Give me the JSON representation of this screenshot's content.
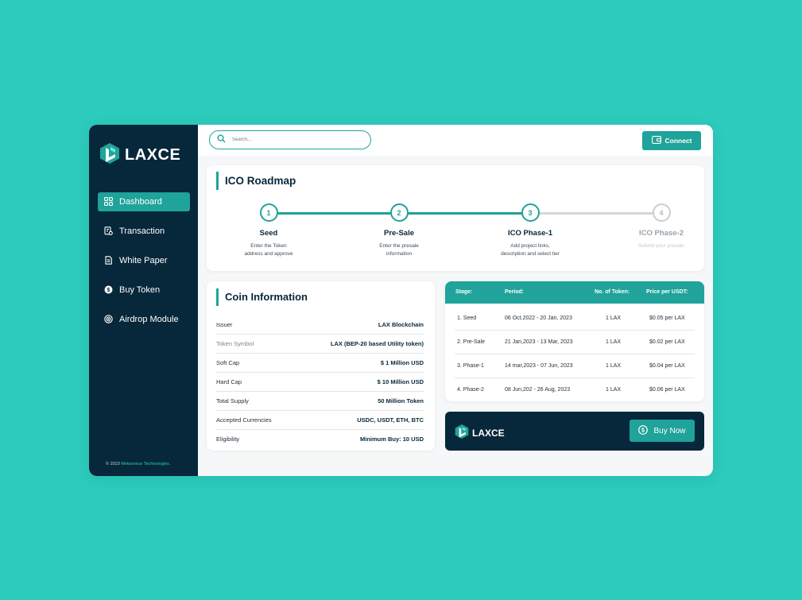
{
  "brand": {
    "name": "LAXCE"
  },
  "sidebar": {
    "items": [
      {
        "label": "Dashboard",
        "icon": "grid-icon",
        "active": true
      },
      {
        "label": "Transaction",
        "icon": "transaction-icon"
      },
      {
        "label": "White Paper",
        "icon": "document-icon"
      },
      {
        "label": "Buy Token",
        "icon": "coin-icon"
      },
      {
        "label": "Airdrop Module",
        "icon": "target-icon"
      }
    ],
    "footer": {
      "prefix": "© 2023 ",
      "company": "Metavoeux Technologies",
      "suffix": "."
    }
  },
  "search": {
    "placeholder": "Search..."
  },
  "header": {
    "connect_label": "Connect"
  },
  "roadmap": {
    "title": "ICO Roadmap",
    "steps": [
      {
        "number": "1",
        "name": "Seed",
        "desc": [
          "Enter the Token",
          "address and approve"
        ],
        "done": true
      },
      {
        "number": "2",
        "name": "Pre-Sale",
        "desc": [
          "Enter the presale",
          "information"
        ],
        "done": true
      },
      {
        "number": "3",
        "name": "ICO Phase-1",
        "desc": [
          "Add project links,",
          "description and select tier"
        ],
        "done": true
      },
      {
        "number": "4",
        "name": "ICO Phase-2",
        "desc": [
          "Submit your presale",
          ""
        ],
        "done": false
      }
    ]
  },
  "coin_info": {
    "title": "Coin Information",
    "rows": [
      {
        "label": "Issuer",
        "value": "LAX Blockchain"
      },
      {
        "label": "Token Symbol",
        "value": "LAX (BEP-20 based Utility token)",
        "muted": true
      },
      {
        "label": "Soft Cap",
        "value": "$ 1 Million USD"
      },
      {
        "label": "Hard Cap",
        "value": "$ 10 Million USD"
      },
      {
        "label": "Total Supply",
        "value": "50 Million Token"
      },
      {
        "label": "Accepted Currencies",
        "value": "USDC, USDT, ETH, BTC"
      },
      {
        "label": "Eligibility",
        "value": "Minimum Buy: 10 USD"
      }
    ]
  },
  "stages_table": {
    "headers": [
      "Stage:",
      "Period:",
      "No. of Token:",
      "Price per USDT:"
    ],
    "rows": [
      [
        "1. Seed",
        "06 Oct,2022 - 20 Jan, 2023",
        "1 LAX",
        "$0.05 per LAX"
      ],
      [
        "2. Pre-Sale",
        "21 Jan,2023 - 13 Mar, 2023",
        "1 LAX",
        "$0.02 per LAX"
      ],
      [
        "3. Phase-1",
        "14 mar,2023 - 07 Jun, 2023",
        "1 LAX",
        "$0.04 per LAX"
      ],
      [
        "4. Phase-2",
        "08 Jun,202 - 26 Aug, 2023",
        "1 LAX",
        "$0.06 per LAX"
      ]
    ]
  },
  "buy_box": {
    "brand": "LAXCE",
    "button_label": "Buy Now"
  },
  "colors": {
    "accent": "#1fa39a",
    "dark": "#07273a",
    "background": "#2ccbbc"
  }
}
